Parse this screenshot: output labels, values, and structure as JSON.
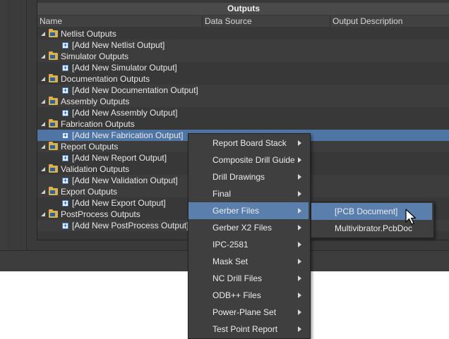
{
  "panel": {
    "title": "Outputs",
    "columns": [
      "Name",
      "Data Source",
      "Output Description"
    ]
  },
  "tree": [
    {
      "group": "Netlist Outputs",
      "item": "[Add New Netlist Output]"
    },
    {
      "group": "Simulator Outputs",
      "item": "[Add New Simulator Output]"
    },
    {
      "group": "Documentation Outputs",
      "item": "[Add New Documentation Output]"
    },
    {
      "group": "Assembly Outputs",
      "item": "[Add New Assembly Output]"
    },
    {
      "group": "Fabrication Outputs",
      "item": "[Add New Fabrication Output]"
    },
    {
      "group": "Report Outputs",
      "item": "[Add New Report Output]"
    },
    {
      "group": "Validation Outputs",
      "item": "[Add New Validation Output]"
    },
    {
      "group": "Export Outputs",
      "item": "[Add New Export Output]"
    },
    {
      "group": "PostProcess Outputs",
      "item": "[Add New PostProcess Output]"
    }
  ],
  "context_menu": [
    "Report Board Stack",
    "Composite Drill Guide",
    "Drill Drawings",
    "Final",
    "Gerber Files",
    "Gerber X2 Files",
    "IPC-2581",
    "Mask Set",
    "NC Drill Files",
    "ODB++ Files",
    "Power-Plane Set",
    "Test Point Report"
  ],
  "submenu": [
    "[PCB Document]",
    "Multivibrator.PcbDoc"
  ],
  "colors": {
    "background": "#3b3b3b",
    "selection": "#4f75a5",
    "menu_highlight": "#5a7fad",
    "folder": "#d8b34a"
  }
}
